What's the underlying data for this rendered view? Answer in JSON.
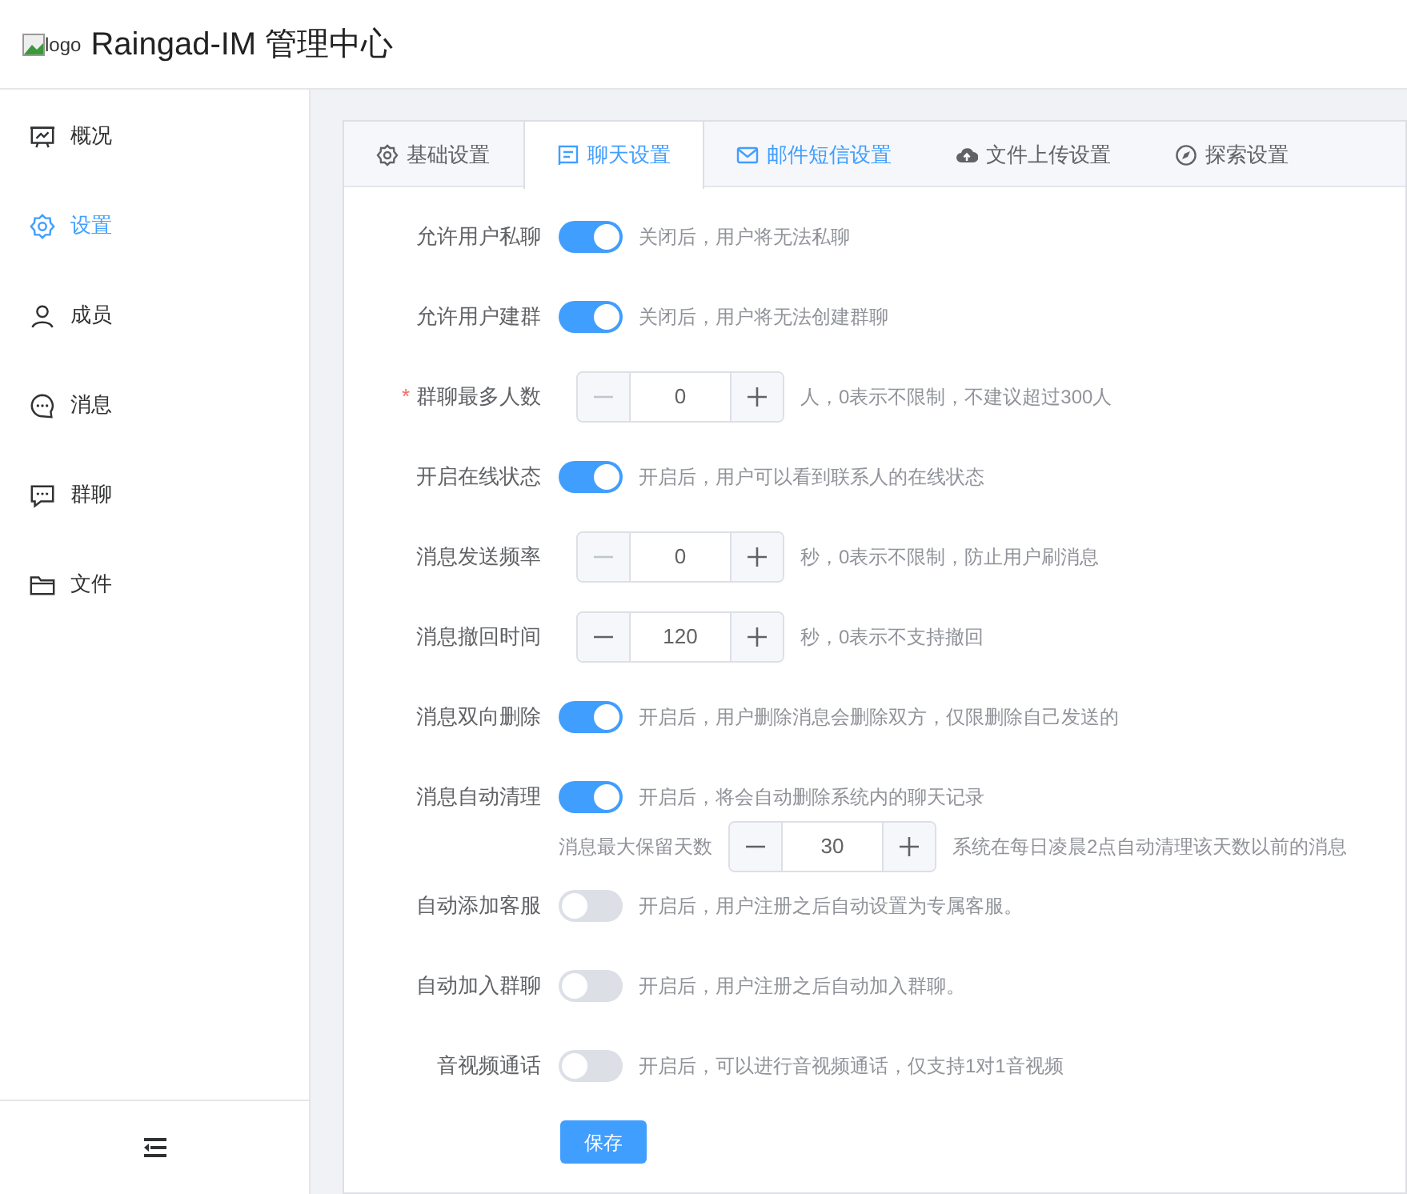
{
  "header": {
    "logo_alt": "logo",
    "title": "Raingad-IM 管理中心"
  },
  "sidebar": {
    "items": [
      {
        "label": "概况",
        "selected": false
      },
      {
        "label": "设置",
        "selected": true
      },
      {
        "label": "成员",
        "selected": false
      },
      {
        "label": "消息",
        "selected": false
      },
      {
        "label": "群聊",
        "selected": false
      },
      {
        "label": "文件",
        "selected": false
      }
    ]
  },
  "tabs": [
    {
      "label": "基础设置",
      "selected": false,
      "hovered": false
    },
    {
      "label": "聊天设置",
      "selected": true,
      "hovered": false
    },
    {
      "label": "邮件短信设置",
      "selected": false,
      "hovered": true
    },
    {
      "label": "文件上传设置",
      "selected": false,
      "hovered": false
    },
    {
      "label": "探索设置",
      "selected": false,
      "hovered": false
    }
  ],
  "settings": [
    {
      "kind": "switch",
      "label": "允许用户私聊",
      "on": true,
      "hint": "关闭后，用户将无法私聊"
    },
    {
      "kind": "switch",
      "label": "允许用户建群",
      "on": true,
      "hint": "关闭后，用户将无法创建群聊"
    },
    {
      "kind": "number",
      "label": "群聊最多人数",
      "required_mark": "*",
      "value": "0",
      "minus_disabled": true,
      "hint": "人，0表示不限制，不建议超过300人"
    },
    {
      "kind": "switch",
      "label": "开启在线状态",
      "on": true,
      "hint": "开启后，用户可以看到联系人的在线状态"
    },
    {
      "kind": "number",
      "label": "消息发送频率",
      "value": "0",
      "minus_disabled": true,
      "hint": "秒，0表示不限制，防止用户刷消息"
    },
    {
      "kind": "number",
      "label": "消息撤回时间",
      "value": "120",
      "minus_disabled": false,
      "hint": "秒，0表示不支持撤回"
    },
    {
      "kind": "switch",
      "label": "消息双向删除",
      "on": true,
      "hint": "开启后，用户删除消息会删除双方，仅限删除自己发送的"
    },
    {
      "kind": "switch",
      "label": "消息自动清理",
      "on": true,
      "hint": "开启后，将会自动删除系统内的聊天记录",
      "sub": {
        "label": "消息最大保留天数",
        "value": "30",
        "minus_disabled": false,
        "hint": "系统在每日凌晨2点自动清理该天数以前的消息"
      }
    },
    {
      "kind": "switch",
      "label": "自动添加客服",
      "on": false,
      "hint": "开启后，用户注册之后自动设置为专属客服。"
    },
    {
      "kind": "switch",
      "label": "自动加入群聊",
      "on": false,
      "hint": "开启后，用户注册之后自动加入群聊。"
    },
    {
      "kind": "switch",
      "label": "音视频通话",
      "on": false,
      "hint": "开启后，可以进行音视频通话，仅支持1对1音视频"
    }
  ],
  "save_button": "保存"
}
